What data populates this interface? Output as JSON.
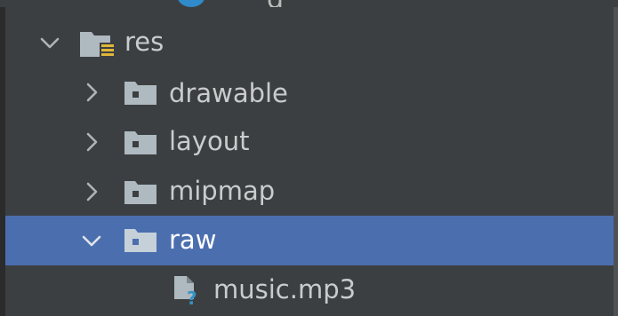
{
  "project_tree": {
    "top_partial": {
      "text": "g"
    },
    "items": [
      {
        "label": "res",
        "depth": 0,
        "expanded": true,
        "icon": "resource-folder-icon"
      },
      {
        "label": "drawable",
        "depth": 1,
        "expanded": false,
        "icon": "folder-icon"
      },
      {
        "label": "layout",
        "depth": 1,
        "expanded": false,
        "icon": "folder-icon"
      },
      {
        "label": "mipmap",
        "depth": 1,
        "expanded": false,
        "icon": "folder-icon"
      },
      {
        "label": "raw",
        "depth": 1,
        "expanded": true,
        "selected": true,
        "icon": "folder-icon"
      },
      {
        "label": "music.mp3",
        "depth": 2,
        "icon": "unknown-file-icon"
      }
    ]
  },
  "colors": {
    "background": "#3c3f41",
    "selection": "#4b6eaf",
    "text": "#c9cbcd",
    "folder": "#aeb9c0",
    "resource_badge": "#e0b63a",
    "unknown_file_badge": "#3592c4"
  }
}
